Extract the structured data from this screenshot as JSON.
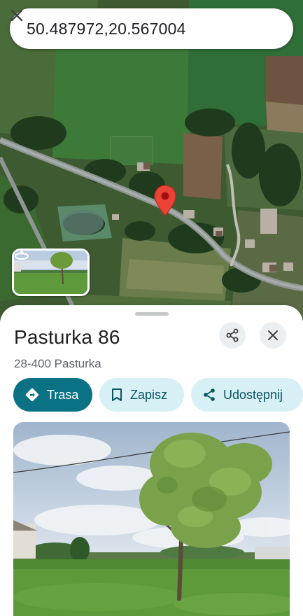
{
  "search": {
    "query": "50.487972,20.567004",
    "close_icon": "close-icon"
  },
  "map": {
    "marker_icon": "map-pin-icon",
    "marker_color": "#ea4335",
    "street_view_icon": "street-view-rotate-icon"
  },
  "place": {
    "title": "Pasturka 86",
    "address": "28-400 Pasturka",
    "share_icon": "share-icon",
    "close_icon": "close-icon"
  },
  "actions": {
    "directions_label": "Trasa",
    "save_label": "Zapisz",
    "share_label": "Udostępnij",
    "primary_color": "#0b7285",
    "secondary_color": "#d6f0f5"
  },
  "photo": {
    "kind": "street-view-photo"
  }
}
